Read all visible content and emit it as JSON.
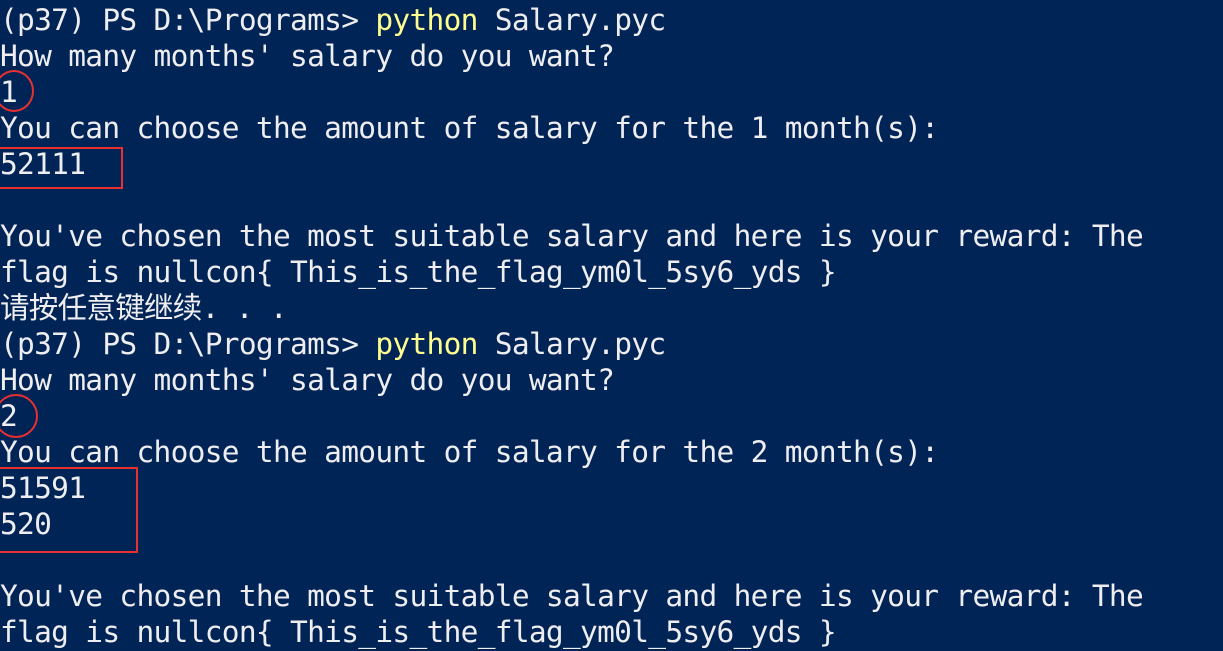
{
  "terminal": {
    "lines": [
      {
        "prompt": "(p37) PS D:\\Programs> ",
        "cmd": "python",
        "args": " Salary.pyc"
      },
      {
        "text": "How many months' salary do you want?"
      },
      {
        "text": "1"
      },
      {
        "text": "You can choose the amount of salary for the 1 month(s):"
      },
      {
        "text": "52111"
      },
      {
        "text": "You've chosen the most suitable salary and here is your reward: The"
      },
      {
        "text": "flag is nullcon{ This_is_the_flag_ym0l_5sy6_yds }"
      },
      {
        "text": "请按任意键继续. . ."
      },
      {
        "prompt": "(p37) PS D:\\Programs> ",
        "cmd": "python",
        "args": " Salary.pyc"
      },
      {
        "text": "How many months' salary do you want?"
      },
      {
        "text": "2"
      },
      {
        "text": "You can choose the amount of salary for the 2 month(s):"
      },
      {
        "text": "51591"
      },
      {
        "text": "520"
      },
      {
        "text": "You've chosen the most suitable salary and here is your reward: The"
      },
      {
        "text": "flag is nullcon{ This_is_the_flag_ym0l_5sy6_yds }"
      }
    ]
  },
  "colors": {
    "background": "#012456",
    "foreground": "#eeedf0",
    "command": "#ffff8f",
    "annotation": "#e8312f"
  }
}
